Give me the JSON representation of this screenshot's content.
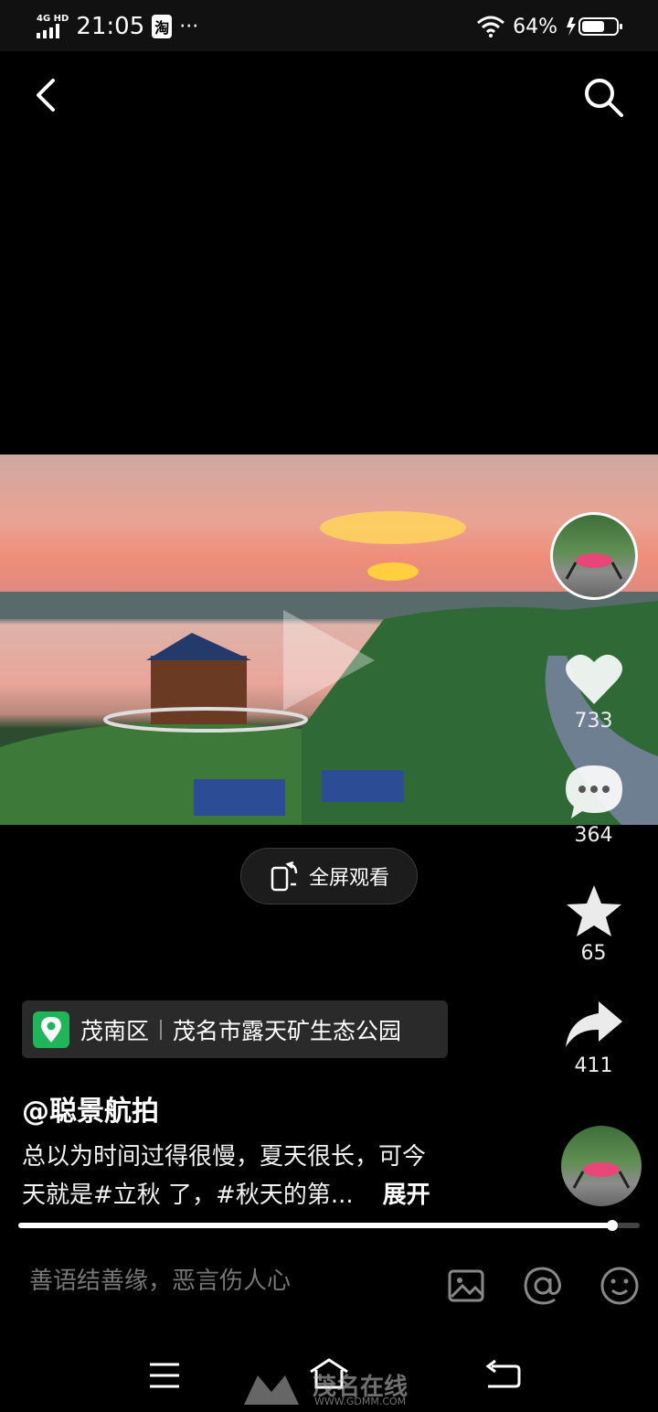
{
  "status_bar": {
    "network": "4G HD",
    "time": "21:05",
    "taobao_badge": "淘",
    "more_dots": "···",
    "battery_percent": "64%"
  },
  "header": {
    "back_icon": "back-arrow-icon",
    "search_icon": "search-icon"
  },
  "video": {
    "fullscreen_label": "全屏观看",
    "progress": 0.956
  },
  "actions": {
    "likes": "733",
    "comments": "364",
    "favorites": "65",
    "shares": "411"
  },
  "location": {
    "district": "茂南区",
    "place": "茂名市露天矿生态公园"
  },
  "post": {
    "author": "@聪景航拍",
    "description_line1": "总以为时间过得很慢，夏天很长，可今",
    "description_line2": "天就是#立秋 了，#秋天的第...",
    "expand_label": "展开"
  },
  "comment_bar": {
    "placeholder": "善语结善缘，恶言伤人心"
  },
  "watermark": {
    "text": "茂名在线",
    "url": "WWW.GDMM.COM"
  },
  "colors": {
    "accent_location": "#1fb65a",
    "background": "#000000"
  }
}
